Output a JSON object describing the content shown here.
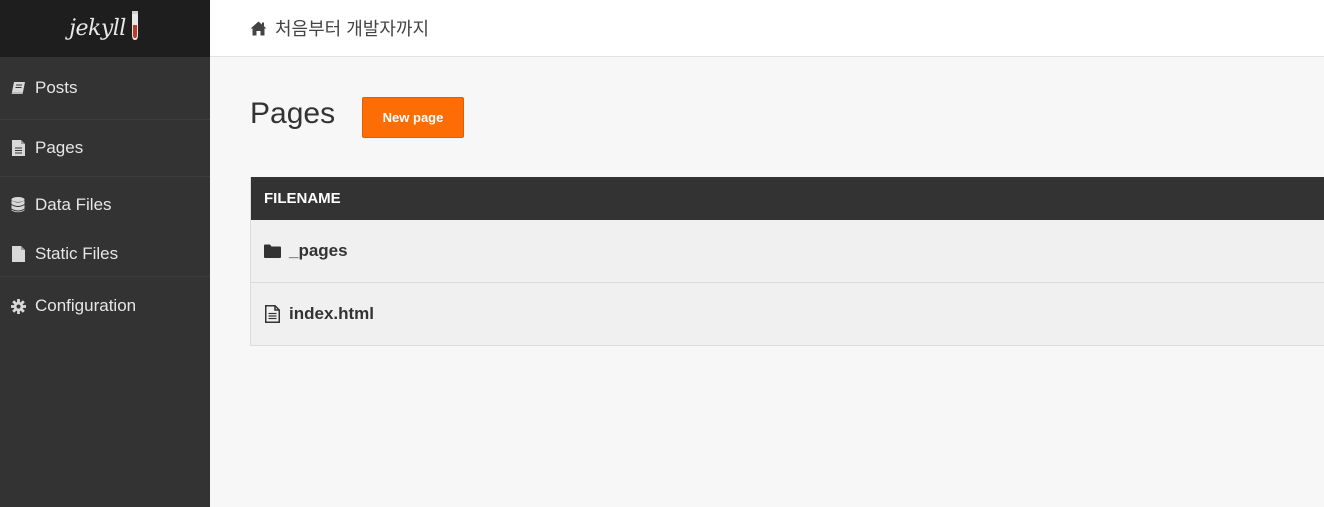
{
  "logo": {
    "text": "jekyll"
  },
  "sidebar": {
    "items": [
      {
        "label": "Posts",
        "icon": "book-icon"
      },
      {
        "label": "Pages",
        "icon": "file-text-icon"
      },
      {
        "label": "Data Files",
        "icon": "database-icon"
      },
      {
        "label": "Static Files",
        "icon": "file-icon"
      },
      {
        "label": "Configuration",
        "icon": "gear-icon"
      }
    ]
  },
  "header": {
    "breadcrumb": "처음부터 개발자까지",
    "icon": "home-icon"
  },
  "main": {
    "title": "Pages",
    "new_button": "New page",
    "table": {
      "header": "FILENAME",
      "rows": [
        {
          "name": "_pages",
          "icon": "folder-icon"
        },
        {
          "name": "index.html",
          "icon": "file-text-icon"
        }
      ]
    }
  },
  "colors": {
    "sidebar_bg": "#333333",
    "logo_bar_bg": "#1e1e1e",
    "accent": "#fc6d05",
    "table_header_bg": "#333333",
    "content_bg": "#f7f7f7"
  }
}
